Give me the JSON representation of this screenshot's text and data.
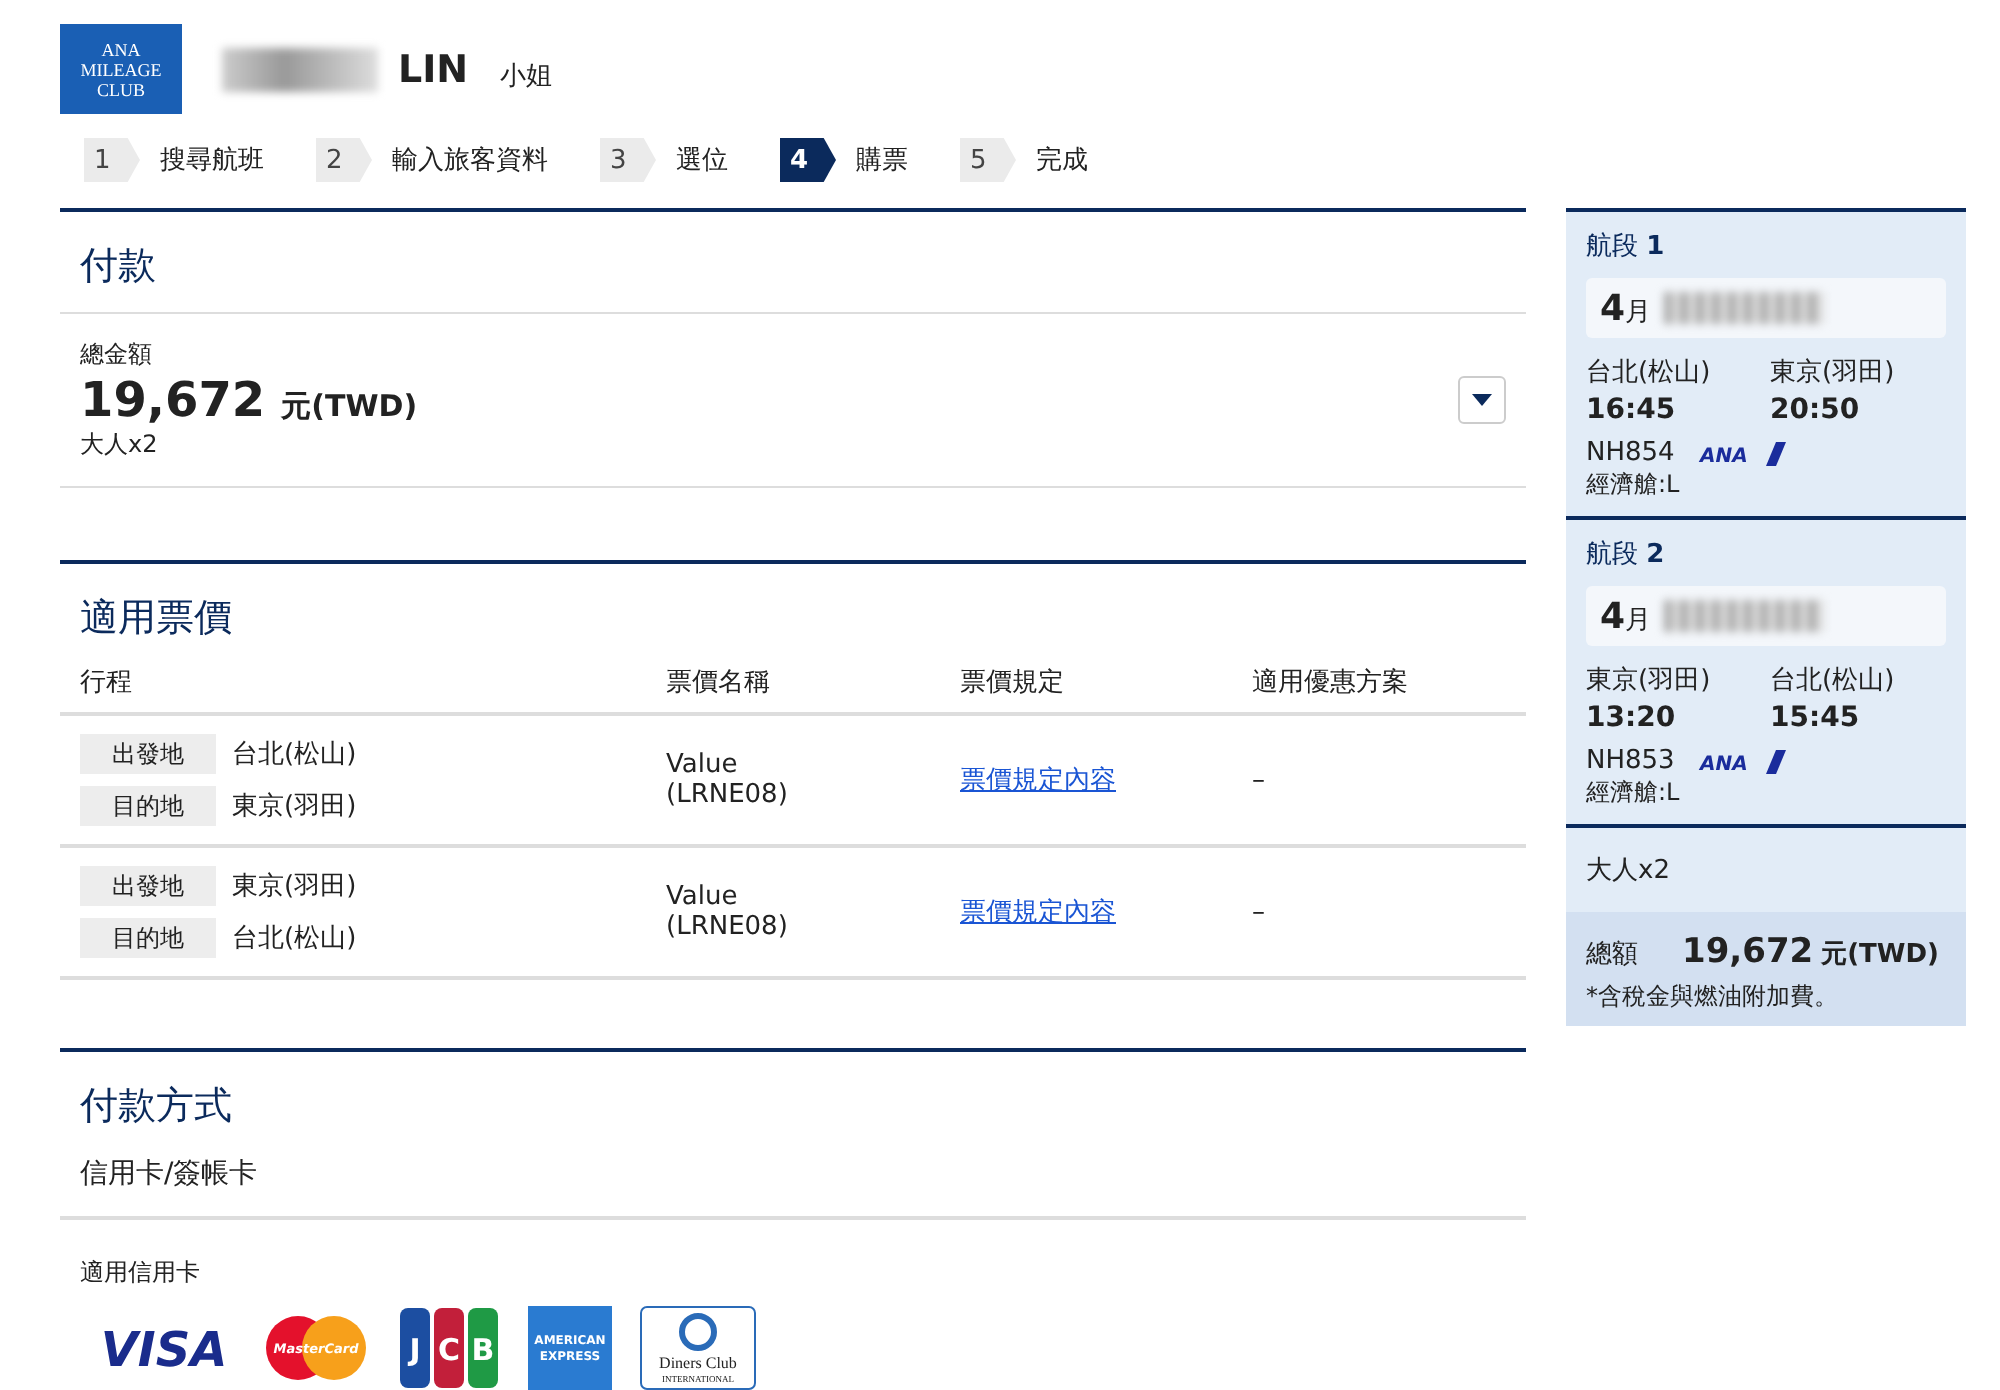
{
  "header": {
    "logo": [
      "ANA",
      "MILEAGE",
      "CLUB"
    ],
    "name_suffix": "LIN",
    "honorific": "小姐"
  },
  "steps": [
    {
      "number": "1",
      "label": "搜尋航班",
      "selected": false
    },
    {
      "number": "2",
      "label": "輸入旅客資料",
      "selected": false
    },
    {
      "number": "3",
      "label": "選位",
      "selected": false
    },
    {
      "number": "4",
      "label": "購票",
      "selected": true
    },
    {
      "number": "5",
      "label": "完成",
      "selected": false
    }
  ],
  "payment": {
    "title": "付款",
    "total_label": "總金額",
    "amount": "19,672",
    "currency": "元(TWD)",
    "passengers": "大人x2",
    "expanded": false
  },
  "fares": {
    "title": "適用票價",
    "columns": [
      "行程",
      "票價名稱",
      "票價規定",
      "適用優惠方案"
    ],
    "rows": [
      {
        "legs": [
          {
            "tag": "出發地",
            "place": "台北(松山)"
          },
          {
            "tag": "目的地",
            "place": "東京(羽田)"
          }
        ],
        "fare_name": [
          "Value",
          "(LRNE08)"
        ],
        "rule_link": "票價規定內容",
        "discount": "–"
      },
      {
        "legs": [
          {
            "tag": "出發地",
            "place": "東京(羽田)"
          },
          {
            "tag": "目的地",
            "place": "台北(松山)"
          }
        ],
        "fare_name": [
          "Value",
          "(LRNE08)"
        ],
        "rule_link": "票價規定內容",
        "discount": "–"
      }
    ]
  },
  "payment_method": {
    "title": "付款方式",
    "method": "信用卡/簽帳卡",
    "cards_label": "適用信用卡",
    "cards": [
      {
        "kind": "visa",
        "text": [
          "VISA"
        ]
      },
      {
        "kind": "mastercard",
        "text": [
          "MasterCard"
        ]
      },
      {
        "kind": "jcb",
        "text": [
          "J",
          "C",
          "B"
        ]
      },
      {
        "kind": "amex",
        "text": [
          "AMERICAN",
          "EXPRESS"
        ]
      },
      {
        "kind": "diners",
        "text": [
          "Diners Club",
          "INTERNATIONAL"
        ]
      }
    ]
  },
  "summary": {
    "segments": [
      {
        "label": "航段 **1**",
        "month": "4",
        "month_unit": "月",
        "from": "台北(松山)",
        "to": "東京(羽田)",
        "depart": "16:45",
        "arrive": "20:50",
        "flight": "NH854",
        "airline": "ANA",
        "cabin": "經濟艙:L"
      },
      {
        "label": "航段 **2**",
        "month": "4",
        "month_unit": "月",
        "from": "東京(羽田)",
        "to": "台北(松山)",
        "depart": "13:20",
        "arrive": "15:45",
        "flight": "NH853",
        "airline": "ANA",
        "cabin": "經濟艙:L"
      }
    ],
    "passengers": "大人x2",
    "total_label": "總額",
    "amount": "19,672",
    "currency": "元(TWD)",
    "note": "*含稅金與燃油附加費。"
  }
}
